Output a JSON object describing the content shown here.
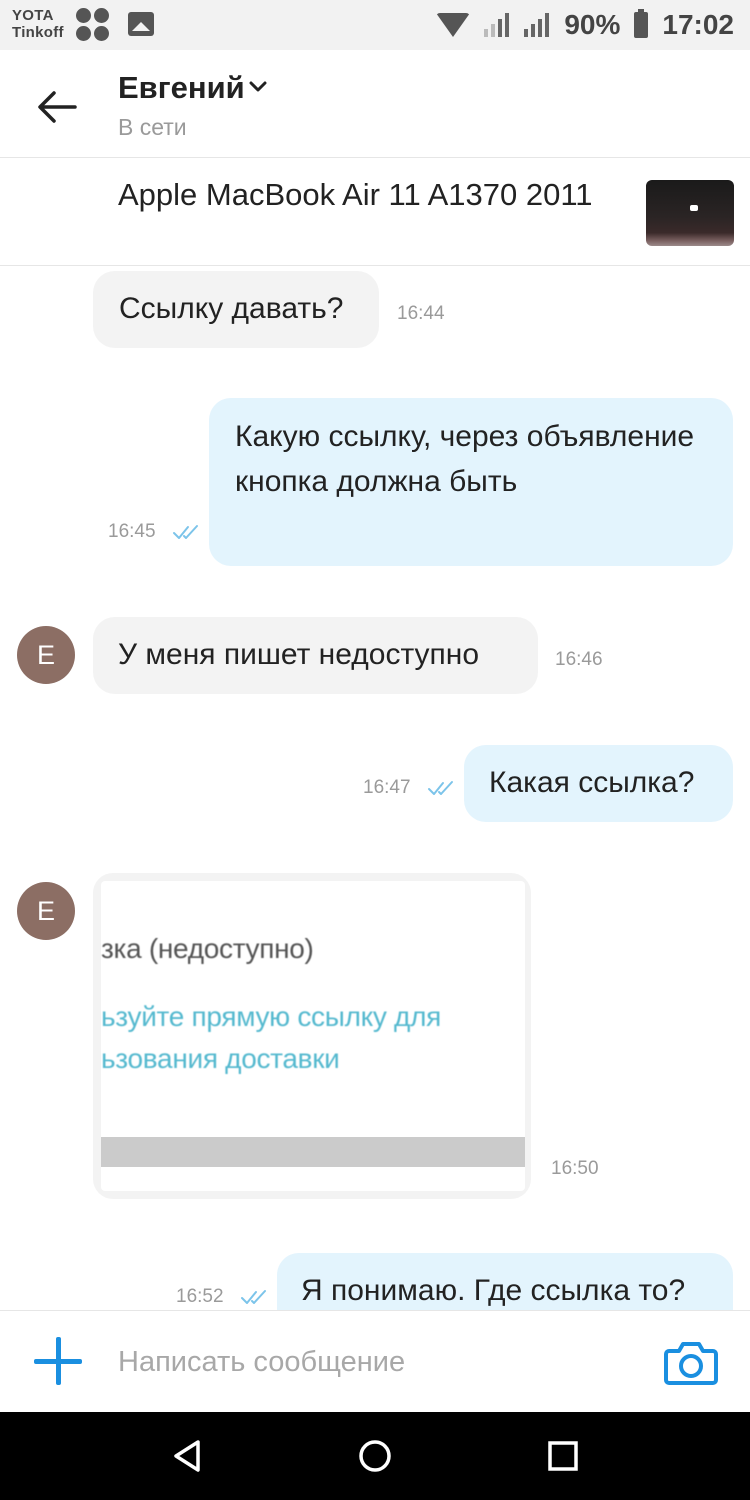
{
  "status_bar": {
    "carrier_line1": "YOTA",
    "carrier_line2": "Tinkoff",
    "battery": "90%",
    "time": "17:02"
  },
  "header": {
    "contact_name": "Евгений",
    "contact_status": "В сети",
    "item_title": "Apple MacBook Air 11 A1370 2011"
  },
  "messages": [
    {
      "dir": "in",
      "text": "Ссылку давать?",
      "time": "16:44"
    },
    {
      "dir": "out",
      "text": "Какую ссылку, через объявление кнопка должна быть",
      "time": "16:45",
      "read": true
    },
    {
      "dir": "in",
      "avatar": "Е",
      "text": "У меня пишет недоступно",
      "time": "16:46"
    },
    {
      "dir": "out",
      "text": "Какая ссылка?",
      "time": "16:47",
      "read": true
    },
    {
      "dir": "in",
      "avatar": "Е",
      "type": "image",
      "time": "16:50",
      "image_text": [
        "зка (недоступно)",
        "ьзуйте прямую ссылку для",
        "ьзования доставки"
      ]
    },
    {
      "dir": "out",
      "text": "Я понимаю. Где ссылка то?",
      "time": "16:52",
      "read": true
    }
  ],
  "composer": {
    "placeholder": "Написать сообщение"
  },
  "icons": [
    "back-arrow-icon",
    "chevron-down-icon",
    "plus-icon",
    "camera-icon",
    "double-check-icon",
    "nav-back-icon",
    "nav-home-icon",
    "nav-recents-icon"
  ],
  "colors": {
    "accent": "#1a8fe0",
    "incoming_bubble": "#f3f3f3",
    "outgoing_bubble": "#e3f4fd",
    "avatar": "#8c6e64"
  }
}
